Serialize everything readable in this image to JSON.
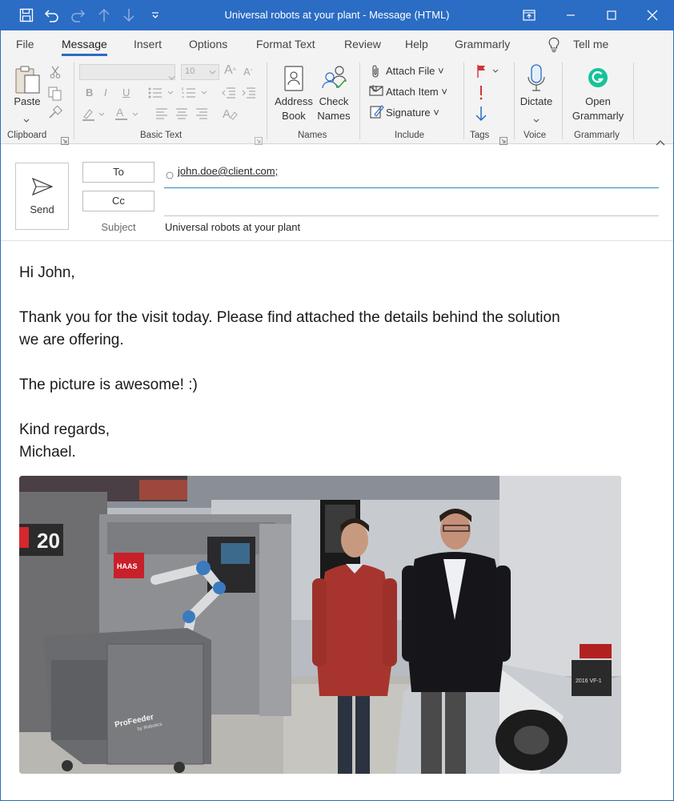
{
  "window": {
    "title": "Universal robots at your plant  -  Message (HTML)"
  },
  "tabs": [
    {
      "label": "File"
    },
    {
      "label": "Message"
    },
    {
      "label": "Insert"
    },
    {
      "label": "Options"
    },
    {
      "label": "Format Text"
    },
    {
      "label": "Review"
    },
    {
      "label": "Help"
    },
    {
      "label": "Grammarly"
    },
    {
      "label": "Tell me"
    }
  ],
  "ribbon": {
    "clipboard": {
      "paste_label": "Paste",
      "group_label": "Clipboard"
    },
    "basic_text": {
      "font_size": "10",
      "group_label": "Basic Text",
      "bold": "B",
      "italic": "I",
      "underline": "U"
    },
    "names": {
      "address_book_line1": "Address",
      "address_book_line2": "Book",
      "check_names_line1": "Check",
      "check_names_line2": "Names",
      "group_label": "Names"
    },
    "include": {
      "attach_file": "Attach File",
      "attach_item": "Attach Item",
      "signature": "Signature",
      "group_label": "Include"
    },
    "tags": {
      "group_label": "Tags"
    },
    "voice": {
      "dictate": "Dictate",
      "group_label": "Voice"
    },
    "grammarly": {
      "open_line1": "Open",
      "open_line2": "Grammarly",
      "group_label": "Grammarly"
    }
  },
  "compose": {
    "send_label": "Send",
    "to_label": "To",
    "cc_label": "Cc",
    "subject_label": "Subject",
    "to_value": "john.doe@client.com;",
    "cc_value": "",
    "subject_value": "Universal robots at your plant"
  },
  "body": {
    "greeting": "Hi John,",
    "line1": "Thank you for the visit today. Please find attached the details behind the solution",
    "line2": "we are offering.",
    "line3": "The picture is awesome! :)",
    "closing": "Kind regards,",
    "signature": "Michael."
  },
  "photo": {
    "machine_number": "20",
    "machine_brand": "HAAS",
    "feeder_label": "ProFeeder",
    "feeder_sublabel": "by Robotics",
    "banner_label": "2016 VF-1"
  },
  "colors": {
    "accent": "#2b6cc4",
    "ribbon_bg": "#f3f3f3",
    "grammarly": "#15c39a",
    "flag_red": "#d13438"
  }
}
